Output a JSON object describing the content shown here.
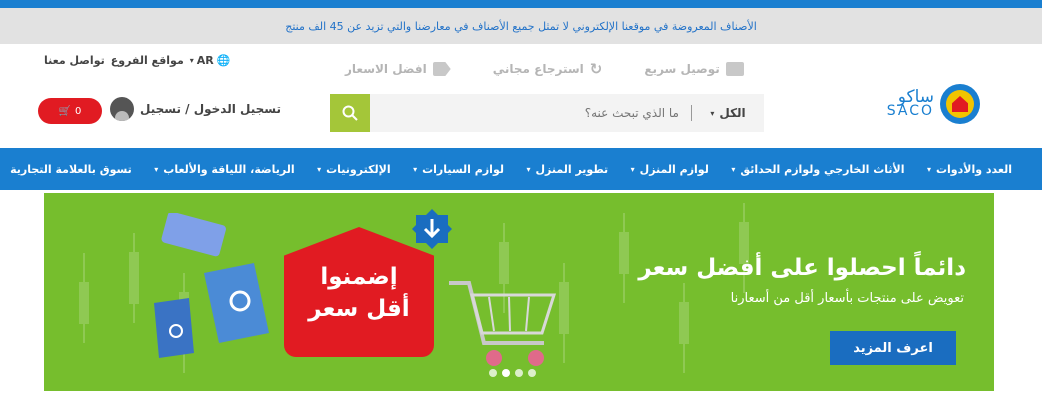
{
  "notice": "الأصناف المعروضة في موقعنا الإلكتروني لا تمثل جميع الأصناف في معارضنا والتي تزيد عن 45 الف منتج",
  "top_links": {
    "contact": "تواصل معنا",
    "branches": "مواقع الفروع",
    "language": "AR"
  },
  "features": [
    {
      "label": "توصيل سريع",
      "icon": "truck-icon"
    },
    {
      "label": "استرجاع مجاني",
      "icon": "return-icon"
    },
    {
      "label": "افضل الاسعار",
      "icon": "tag-icon"
    }
  ],
  "logo": {
    "arabic": "ساكو",
    "english": "SACO"
  },
  "search": {
    "category": "الكل",
    "placeholder": "ما الذي تبحث عنه؟"
  },
  "account": {
    "login_label": "تسجيل الدخول / تسجيل",
    "cart_count": "0"
  },
  "nav": [
    "العدد والأدوات",
    "الأثاث الخارجي ولوازم الحدائق",
    "لوازم المنزل",
    "تطوير المنزل",
    "لوازم السيارات",
    "الإلكترونيات",
    "الرياضة، اللياقة والألعاب",
    "تسوق بالعلامة التجارية"
  ],
  "banner": {
    "title": "دائماً احصلوا على أفضل سعر",
    "subtitle": "تعويض على منتجات بأسعار أقل من أسعارنا",
    "cta": "اعرف المزيد",
    "tag_line1": "إضمنوا",
    "tag_line2": "أقل سعر",
    "slides": 4,
    "active_slide": 2
  },
  "colors": {
    "brand_blue": "#1a7fd0",
    "accent_red": "#e11b22",
    "search_green": "#a4c639",
    "banner_green": "#76be2d"
  }
}
